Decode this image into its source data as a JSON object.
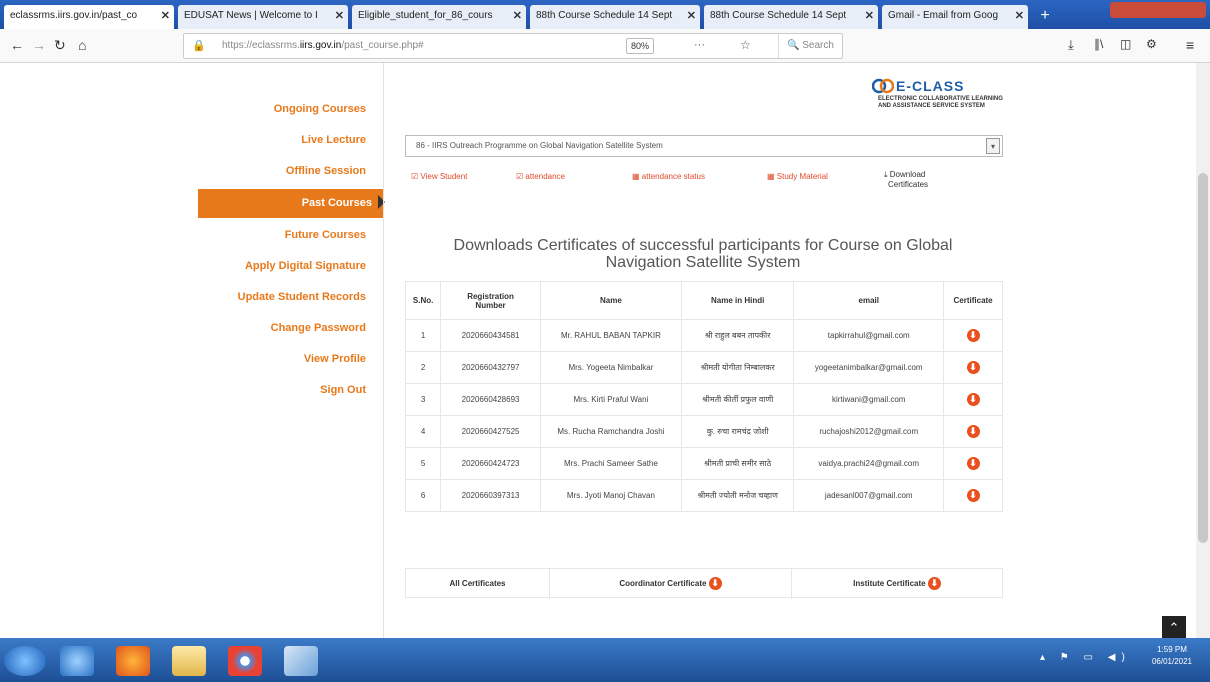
{
  "browser": {
    "tabs": [
      {
        "title": "eclassrms.iirs.gov.in/past_co"
      },
      {
        "title": "EDUSAT News | Welcome to I"
      },
      {
        "title": "Eligible_student_for_86_cours"
      },
      {
        "title": "88th Course Schedule 14 Sept"
      },
      {
        "title": "88th Course Schedule 14 Sept"
      },
      {
        "title": "Gmail - Email from Goog"
      }
    ],
    "url_prefix": "https://eclassrms.",
    "url_domain": "iirs.gov.in",
    "url_path": "/past_course.php#",
    "zoom": "80%",
    "search_placeholder": "Search"
  },
  "logo": {
    "title": "E-CLASS",
    "subtitle": "ELECTRONIC COLLABORATIVE LEARNING AND ASSISTANCE SERVICE SYSTEM"
  },
  "sidebar": {
    "items": [
      {
        "label": "Ongoing Courses"
      },
      {
        "label": "Live Lecture"
      },
      {
        "label": "Offline Session"
      },
      {
        "label": "Past Courses"
      },
      {
        "label": "Future Courses"
      },
      {
        "label": "Apply Digital Signature"
      },
      {
        "label": "Update Student Records"
      },
      {
        "label": "Change Password"
      },
      {
        "label": "View Profile"
      },
      {
        "label": "Sign Out"
      }
    ],
    "active_index": 3
  },
  "course_select": {
    "value": "86 - IIRS Outreach Programme on Global Navigation Satellite System"
  },
  "actions": {
    "view_student": "View Student",
    "attendance": "attendance",
    "attendance_status": "attendance status",
    "study_material": "Study Material",
    "download_certificates_1": "Download",
    "download_certificates_2": "Certificates"
  },
  "heading": {
    "line1": "Downloads Certificates of successful participants for Course on Global",
    "line2": "Navigation Satellite System"
  },
  "table": {
    "headers": {
      "sno": "S.No.",
      "reg_1": "Registration",
      "reg_2": "Number",
      "name": "Name",
      "hindi": "Name in Hindi",
      "email": "email",
      "certificate": "Certificate"
    },
    "rows": [
      {
        "sno": "1",
        "reg": "2020660434581",
        "name": "Mr. RAHUL BABAN TAPKIR",
        "hindi": "श्री राहुल बबन तापकीर",
        "email": "tapkirrahul@gmail.com"
      },
      {
        "sno": "2",
        "reg": "2020660432797",
        "name": "Mrs. Yogeeta Nimbalkar",
        "hindi": "श्रीमती योगीता निम्बालकर",
        "email": "yogeetanimbalkar@gmail.com"
      },
      {
        "sno": "3",
        "reg": "2020660428693",
        "name": "Mrs. Kirti Praful Wani",
        "hindi": "श्रीमती कीर्ती प्रफुल वाणी",
        "email": "kirtiwani@gmail.com"
      },
      {
        "sno": "4",
        "reg": "2020660427525",
        "name": "Ms. Rucha Ramchandra Joshi",
        "hindi": "कु. रुचा रामचंद्र जोशी",
        "email": "ruchajoshi2012@gmail.com"
      },
      {
        "sno": "5",
        "reg": "2020660424723",
        "name": "Mrs. Prachi Sameer Sathe",
        "hindi": "श्रीमती प्राची समीर साठे",
        "email": "vaidya.prachi24@gmail.com"
      },
      {
        "sno": "6",
        "reg": "2020660397313",
        "name": "Mrs. Jyoti Manoj Chavan",
        "hindi": "श्रीमती ज्योती मनोज चव्हाण",
        "email": "jadesanl007@gmail.com"
      }
    ]
  },
  "cert_bar": {
    "all": "All Certificates",
    "coordinator": "Coordinator Certificate",
    "institute": "Institute Certificate"
  },
  "taskbar": {
    "time": "1:59 PM",
    "date": "06/01/2021"
  }
}
